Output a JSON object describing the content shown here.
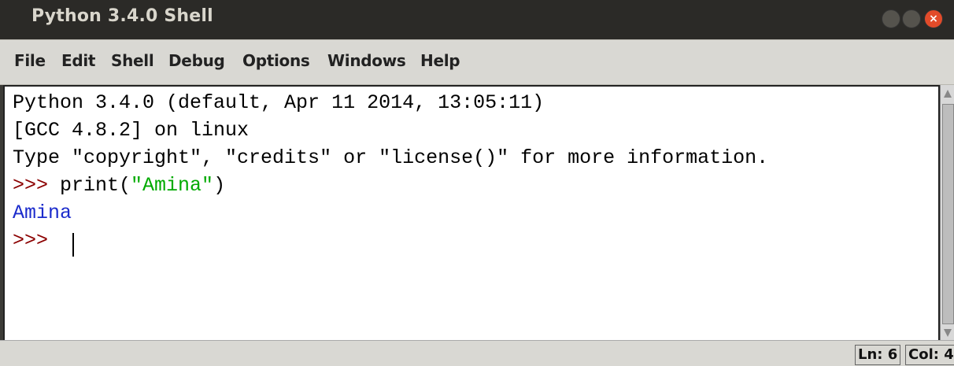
{
  "window": {
    "title": "Python 3.4.0 Shell",
    "close_glyph": "×"
  },
  "menu": {
    "items": [
      {
        "label": "File",
        "underline": "F"
      },
      {
        "label": "Edit",
        "underline": "E"
      },
      {
        "label": "Shell",
        "underline": "S"
      },
      {
        "label": "Debug",
        "underline": "D"
      },
      {
        "label": "Options",
        "underline": "O"
      },
      {
        "label": "Windows",
        "underline": "W"
      },
      {
        "label": "Help",
        "underline": "H"
      }
    ]
  },
  "shell": {
    "line1": "Python 3.4.0 (default, Apr 11 2014, 13:05:11)",
    "line2": "[GCC 4.8.2] on linux",
    "line3": "Type \"copyright\", \"credits\" or \"license()\" for more information.",
    "line4_prompt": ">>> ",
    "line4_code_start": "print(",
    "line4_string": "\"Amina\"",
    "line4_code_end": ")",
    "line5_output": "Amina",
    "line6_prompt": ">>> "
  },
  "status": {
    "ln": "Ln: 6",
    "col": "Col: 4"
  },
  "colors": {
    "prompt": "#8b0000",
    "string": "#00aa00",
    "output": "#1c2ccc",
    "close_button": "#e24b2a"
  },
  "icons": {
    "minimize": "minimize-icon",
    "maximize": "maximize-icon",
    "close": "close-icon"
  }
}
